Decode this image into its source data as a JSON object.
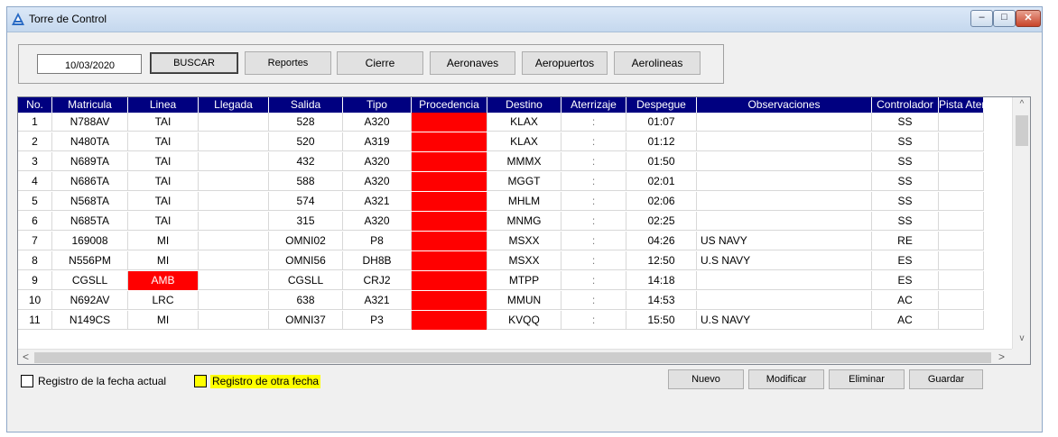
{
  "window": {
    "title": "Torre de Control",
    "minimize": "–",
    "maximize": "□",
    "close": "✕"
  },
  "toolbar": {
    "date_value": "10/03/2020",
    "buscar": "BUSCAR",
    "reportes": "Reportes",
    "cierre": "Cierre",
    "aeronaves": "Aeronaves",
    "aeropuertos": "Aeropuertos",
    "aerolineas": "Aerolineas"
  },
  "table": {
    "columns": [
      "No.",
      "Matricula",
      "Linea",
      "Llegada",
      "Salida",
      "Tipo",
      "Procedencia",
      "Destino",
      "Aterrizaje",
      "Despegue",
      "Observaciones",
      "Controlador",
      "Pista Aterrizaje"
    ],
    "rows": [
      [
        "1",
        "N788AV",
        "TAI",
        "",
        "528",
        "A320",
        "",
        "KLAX",
        ":",
        "01:07",
        "",
        "SS",
        ""
      ],
      [
        "2",
        "N480TA",
        "TAI",
        "",
        "520",
        "A319",
        "",
        "KLAX",
        ":",
        "01:12",
        "",
        "SS",
        ""
      ],
      [
        "3",
        "N689TA",
        "TAI",
        "",
        "432",
        "A320",
        "",
        "MMMX",
        ":",
        "01:50",
        "",
        "SS",
        ""
      ],
      [
        "4",
        "N686TA",
        "TAI",
        "",
        "588",
        "A320",
        "",
        "MGGT",
        ":",
        "02:01",
        "",
        "SS",
        ""
      ],
      [
        "5",
        "N568TA",
        "TAI",
        "",
        "574",
        "A321",
        "",
        "MHLM",
        ":",
        "02:06",
        "",
        "SS",
        ""
      ],
      [
        "6",
        "N685TA",
        "TAI",
        "",
        "315",
        "A320",
        "",
        "MNMG",
        ":",
        "02:25",
        "",
        "SS",
        ""
      ],
      [
        "7",
        "169008",
        "MI",
        "",
        "OMNI02",
        "P8",
        "",
        "MSXX",
        ":",
        "04:26",
        "US NAVY",
        "RE",
        ""
      ],
      [
        "8",
        "N556PM",
        "MI",
        "",
        "OMNI56",
        "DH8B",
        "",
        "MSXX",
        ":",
        "12:50",
        "U.S NAVY",
        "ES",
        ""
      ],
      [
        "9",
        "CGSLL",
        "AMB",
        "",
        "CGSLL",
        "CRJ2",
        "",
        "MTPP",
        ":",
        "14:18",
        "",
        "ES",
        ""
      ],
      [
        "10",
        "N692AV",
        "LRC",
        "",
        "638",
        "A321",
        "",
        "MMUN",
        ":",
        "14:53",
        "",
        "AC",
        ""
      ],
      [
        "11",
        "N149CS",
        "MI",
        "",
        "OMNI37",
        "P3",
        "",
        "KVQQ",
        ":",
        "15:50",
        "U.S NAVY",
        "AC",
        ""
      ]
    ]
  },
  "scroll": {
    "up": "^",
    "down": "v",
    "left": "<",
    "right": ">"
  },
  "legend": {
    "current": "Registro de la fecha actual",
    "other": "Registro de otra fecha"
  },
  "actions": {
    "nuevo": "Nuevo",
    "modificar": "Modificar",
    "eliminar": "Eliminar",
    "guardar": "Guardar"
  },
  "colors": {
    "header_bg": "#000080",
    "highlight_red": "#ff0000",
    "legend_yellow": "#ffff00"
  },
  "icons": {
    "app": "control-tower-logo-icon"
  }
}
